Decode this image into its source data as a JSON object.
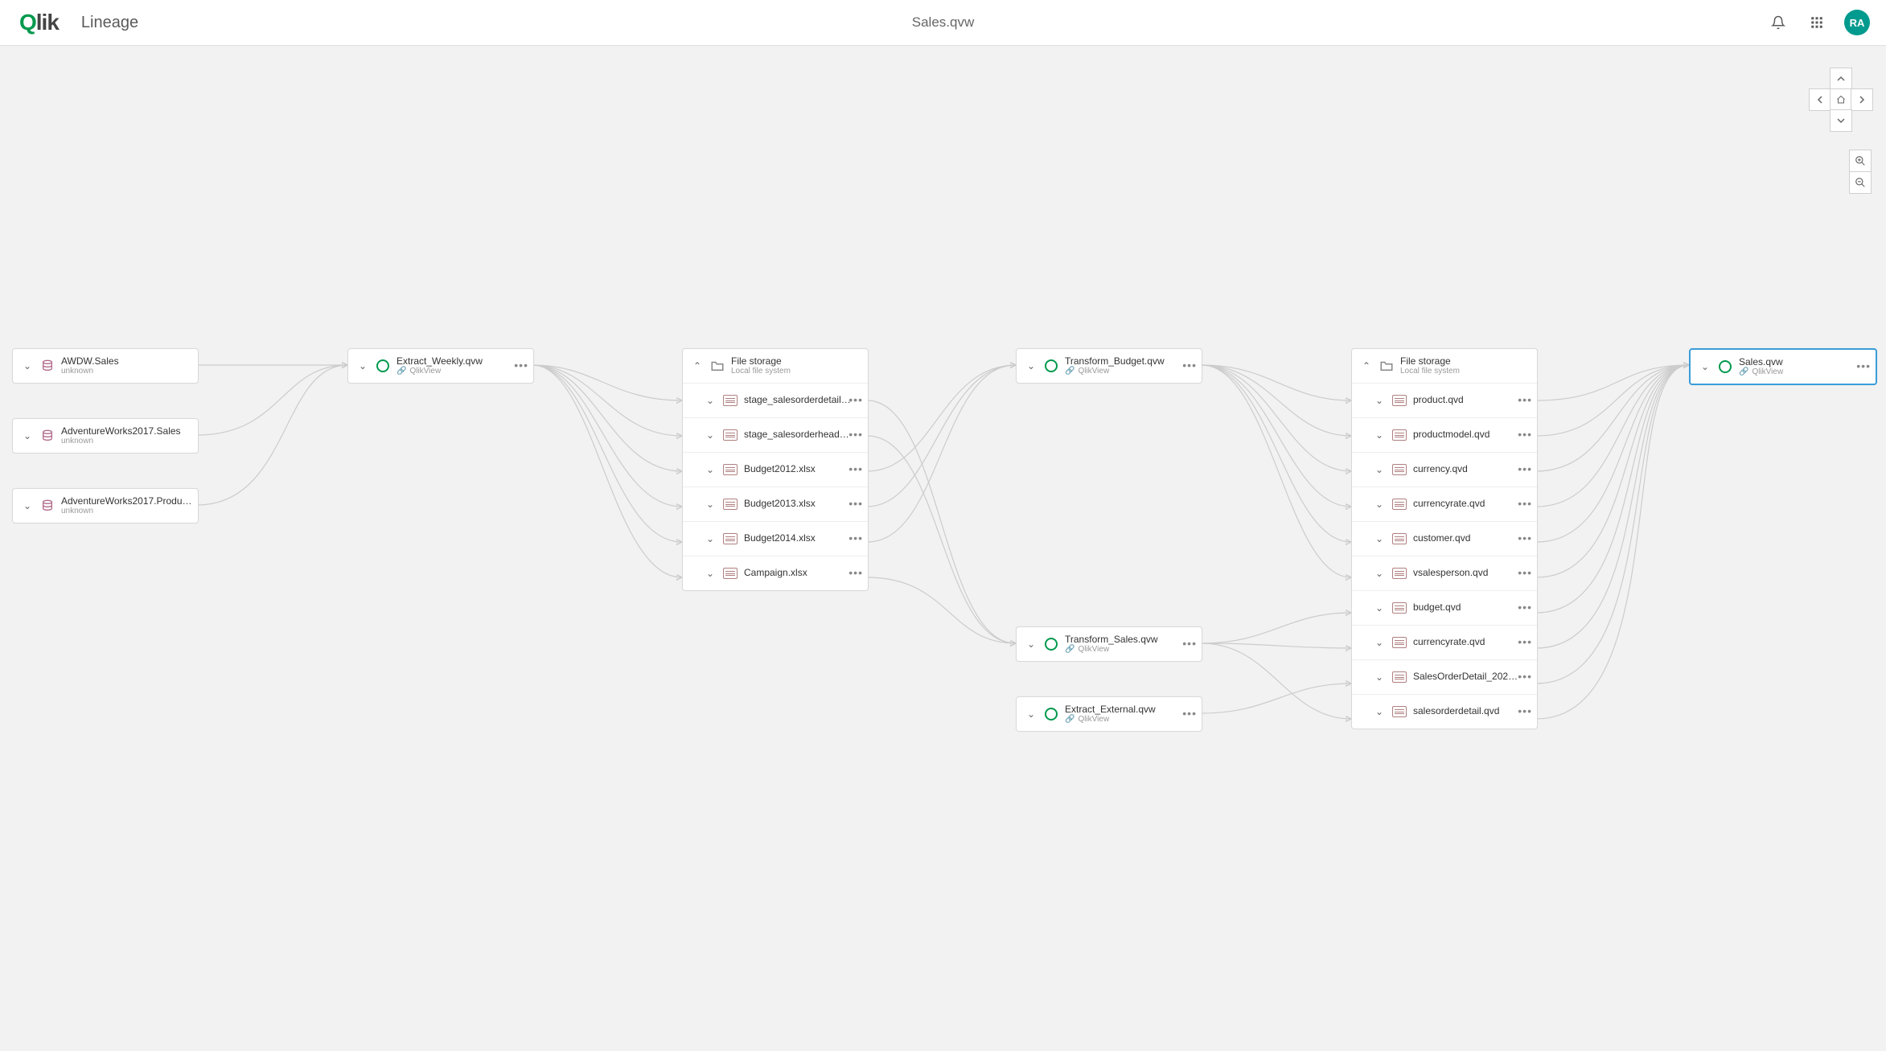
{
  "header": {
    "logo_prefix": "Q",
    "logo_rest": "lik",
    "section": "Lineage",
    "document": "Sales.qvw",
    "avatar_initials": "RA"
  },
  "nodes": {
    "src1": {
      "title": "AWDW.Sales",
      "sub": "unknown"
    },
    "src2": {
      "title": "AdventureWorks2017.Sales",
      "sub": "unknown"
    },
    "src3": {
      "title": "AdventureWorks2017.Produ…",
      "sub": "unknown"
    },
    "extract_weekly": {
      "title": "Extract_Weekly.qvw",
      "sub": "QlikView"
    },
    "storage1": {
      "title": "File storage",
      "sub": "Local file system",
      "rows": [
        "stage_salesorderdetail…",
        "stage_salesorderhead…",
        "Budget2012.xlsx",
        "Budget2013.xlsx",
        "Budget2014.xlsx",
        "Campaign.xlsx"
      ]
    },
    "transform_budget": {
      "title": "Transform_Budget.qvw",
      "sub": "QlikView"
    },
    "transform_sales": {
      "title": "Transform_Sales.qvw",
      "sub": "QlikView"
    },
    "extract_external": {
      "title": "Extract_External.qvw",
      "sub": "QlikView"
    },
    "storage2": {
      "title": "File storage",
      "sub": "Local file system",
      "rows": [
        "product.qvd",
        "productmodel.qvd",
        "currency.qvd",
        "currencyrate.qvd",
        "customer.qvd",
        "vsalesperson.qvd",
        "budget.qvd",
        "currencyrate.qvd",
        "SalesOrderDetail_202…",
        "salesorderdetail.qvd"
      ]
    },
    "sales_qvw": {
      "title": "Sales.qvw",
      "sub": "QlikView"
    }
  }
}
